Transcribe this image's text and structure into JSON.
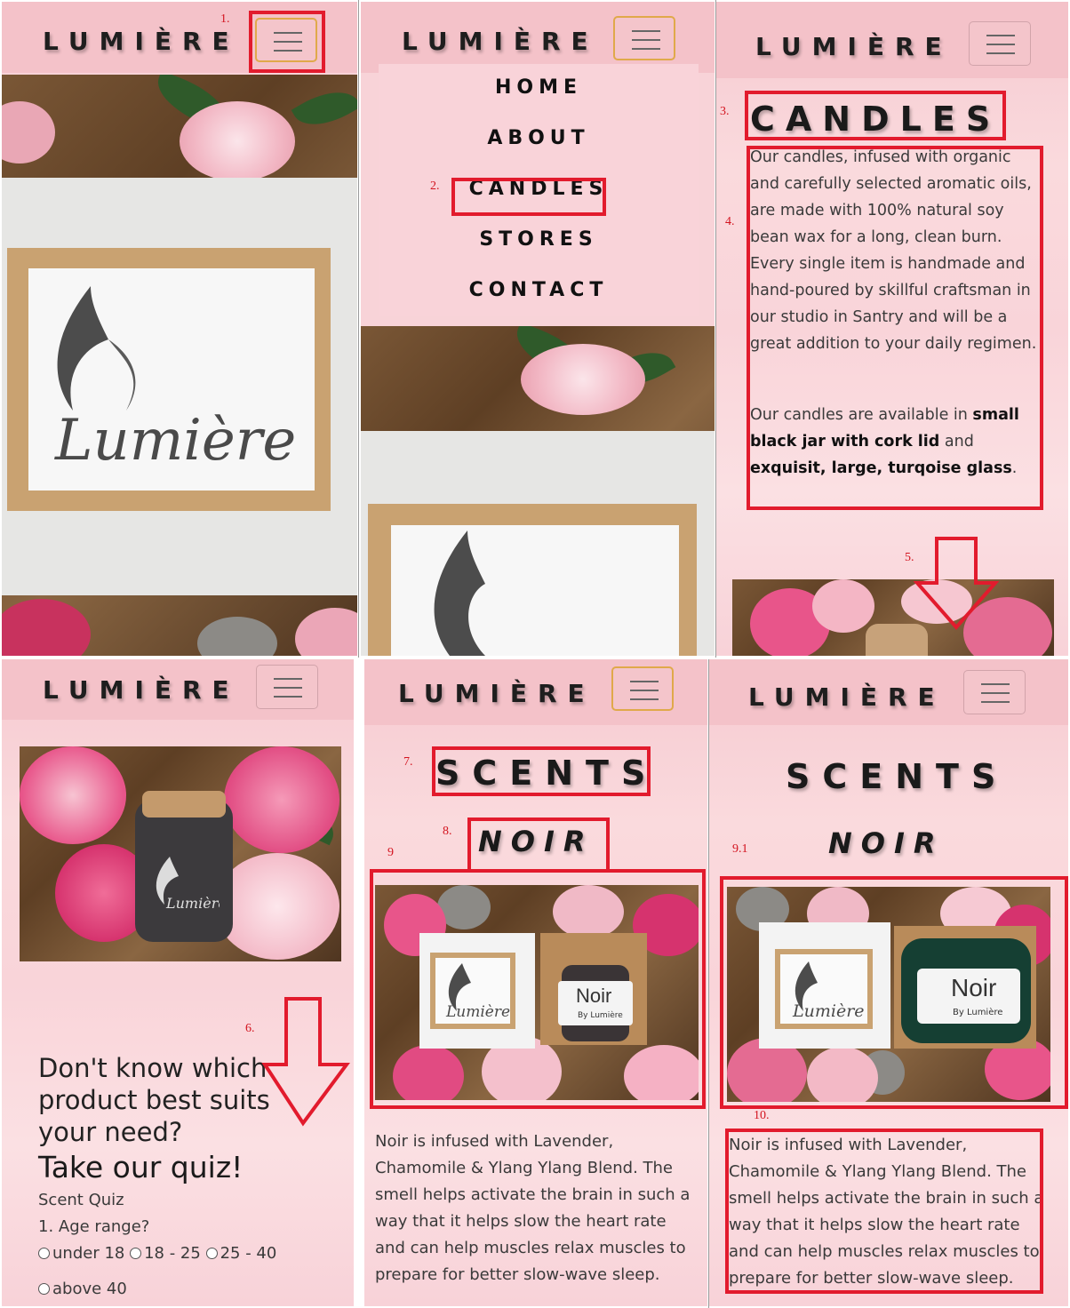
{
  "brand": "LUMIÈRE",
  "annotations": {
    "n1": "1.",
    "n2": "2.",
    "n3": "3.",
    "n4": "4.",
    "n5": "5.",
    "n6": "6.",
    "n7": "7.",
    "n8": "8.",
    "n9": "9",
    "n91": "9.1",
    "n10": "10."
  },
  "menu": {
    "items": [
      "HOME",
      "ABOUT",
      "CANDLES",
      "STORES",
      "CONTACT"
    ]
  },
  "candles": {
    "heading": "CANDLES",
    "paragraph1": "Our candles, infused with organic and carefully selected aromatic oils, are made with 100% natural soy bean wax for a long, clean burn. Every single item is handmade and hand-poured by skillful craftsman in our studio in Santry and will be a great addition to your daily regimen.",
    "p2_start": "Our candles are available in ",
    "p2_bold1": "small black jar with cork lid",
    "p2_mid": " and ",
    "p2_bold2": "exquisit, large, turqoise glass",
    "p2_end": "."
  },
  "logo": {
    "script": "Lumière"
  },
  "quiz": {
    "prompt": "Don't know which product best suits your need?",
    "cta": "Take our quiz!",
    "title": "Scent Quiz",
    "question1": "1. Age range?",
    "options": [
      "under 18",
      "18 - 25",
      "25 - 40",
      "above 40"
    ]
  },
  "scents": {
    "heading": "SCENTS",
    "subheading": "NOIR",
    "label": "Noir",
    "label_sub": "By Lumière",
    "description": "Noir is infused with Lavender, Chamomile & Ylang Ylang Blend. The smell helps activate the brain in such a way that it helps slow the heart rate and can help muscles relax muscles to prepare for better slow-wave sleep."
  },
  "colors": {
    "annotation": "#e21b2d",
    "navbar": "#f4c2c9",
    "toggler_active": "#e0a94a"
  }
}
